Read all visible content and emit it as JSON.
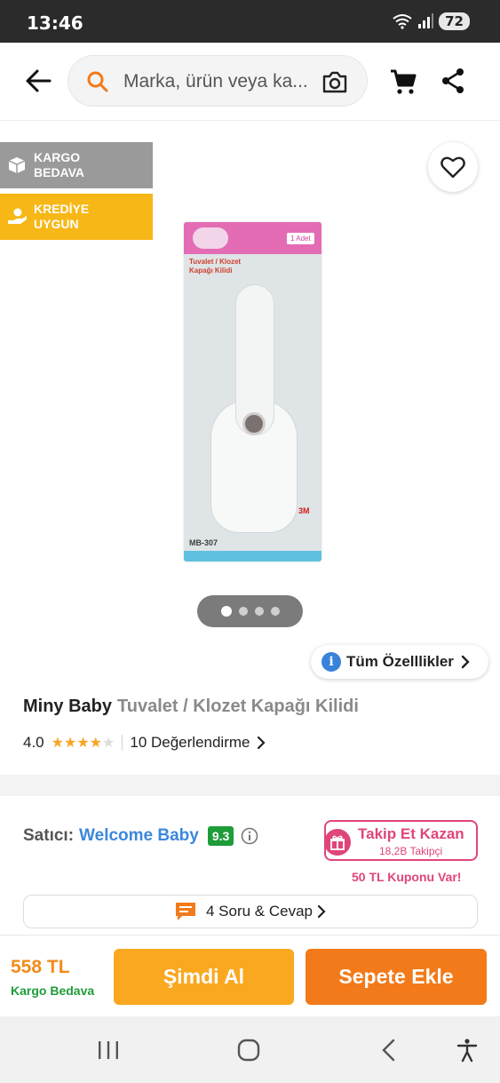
{
  "status_bar": {
    "time": "13:46",
    "battery": "72"
  },
  "search": {
    "placeholder": "Marka, ürün veya ka..."
  },
  "badges": {
    "cargo_line1": "KARGO",
    "cargo_line2": "BEDAVA",
    "credit_line1": "KREDİYE",
    "credit_line2": "UYGUN",
    "cargo_color": "#9a9a9a",
    "credit_color": "#f7b716"
  },
  "product_image": {
    "qty": "1 Adet",
    "title_line1": "Tuvalet / Klozet",
    "title_line2": "Kapağı Kilidi",
    "code": "MB-307",
    "brand_mark": "3M"
  },
  "gallery": {
    "dots": 4,
    "active_dot": 0
  },
  "all_features_label": "Tüm Özelllikler",
  "product": {
    "brand": "Miny Baby",
    "title": "Tuvalet / Klozet Kapağı Kilidi",
    "rating": "4.0",
    "rating_value": 4,
    "review_link": "10 Değerlendirme"
  },
  "seller": {
    "label": "Satıcı:",
    "name": "Welcome Baby",
    "score": "9.3",
    "follow_title": "Takip Et Kazan",
    "follow_count": "18,2B Takipçi",
    "coupon": "50 TL Kuponu Var!"
  },
  "qa": {
    "label": "4 Soru & Cevap"
  },
  "bottom": {
    "price": "558 TL",
    "shipping": "Kargo Bedava",
    "buy_now": "Şimdi Al",
    "add_to_cart": "Sepete Ekle"
  },
  "colors": {
    "orange": "#f27a1a",
    "yellow": "#f9a820",
    "pink": "#e0457a",
    "blue": "#3b87dc",
    "green": "#1e9c3a"
  }
}
